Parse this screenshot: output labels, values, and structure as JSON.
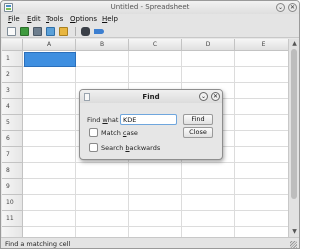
{
  "window": {
    "title": "Untitled - Spreadsheet",
    "minimize_glyph": "⌄",
    "close_glyph": "✕"
  },
  "menubar": {
    "items": [
      {
        "label": "File",
        "mnemonic": "F",
        "rest": "ile"
      },
      {
        "label": "Edit",
        "mnemonic": "E",
        "rest": "dit"
      },
      {
        "label": "Tools",
        "mnemonic": "T",
        "rest": "ools"
      },
      {
        "label": "Options",
        "mnemonic": "O",
        "rest": "ptions"
      },
      {
        "label": "Help",
        "mnemonic": "H",
        "rest": "elp"
      }
    ]
  },
  "toolbar": {
    "icons": [
      "new-document-icon",
      "save-icon",
      "open-icon",
      "table-icon",
      "insert-icon",
      "find-icon",
      "pin-icon"
    ]
  },
  "sheet": {
    "columns": [
      "A",
      "B",
      "C",
      "D",
      "E"
    ],
    "rows": [
      "1",
      "2",
      "3",
      "4",
      "5",
      "6",
      "7",
      "8",
      "9",
      "10",
      "11"
    ],
    "selected_cell": "A1"
  },
  "find_dialog": {
    "title": "Find",
    "find_label_pre": "Find ",
    "find_label_mnemonic": "w",
    "find_label_post": "hat",
    "find_value": "KDE",
    "find_button_mnemonic": "F",
    "find_button_rest": "ind",
    "close_button": "Close",
    "match_case_pre": "Match ",
    "match_case_mnemonic": "c",
    "match_case_post": "ase",
    "search_backwards_pre": "Search ",
    "search_backwards_mnemonic": "b",
    "search_backwards_post": "ackwards",
    "match_case_checked": false,
    "search_backwards_checked": false,
    "help_glyph": "⌄",
    "close_glyph": "✕"
  },
  "statusbar": {
    "text": "Find a matching cell"
  },
  "colors": {
    "selection": "#3f8fe0",
    "input_focus": "#6fa6dd"
  }
}
